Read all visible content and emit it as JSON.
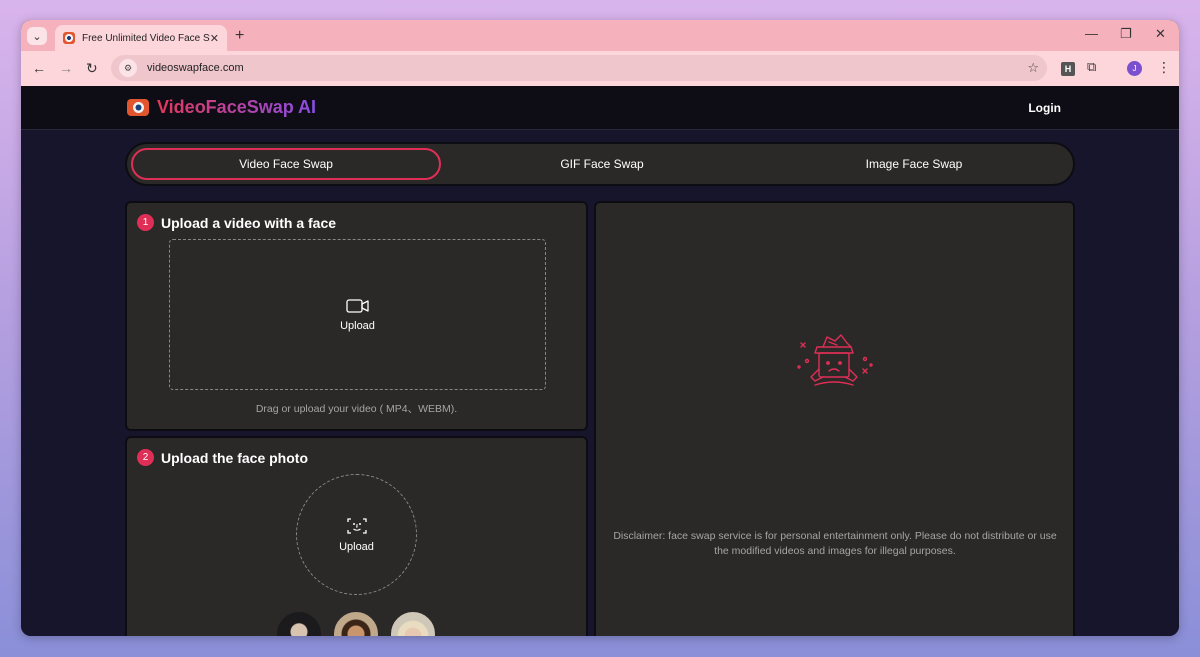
{
  "browser": {
    "tab_title": "Free Unlimited Video Face Swap",
    "tab_close": "✕",
    "new_tab": "+",
    "url": "videoswapface.com",
    "extension_h": "H",
    "profile_initial": "J",
    "icons": {
      "tab_search": "chevron-down-icon",
      "back": "back-arrow-icon",
      "forward": "forward-arrow-icon",
      "reload": "reload-icon",
      "site_info": "site-info-icon",
      "bookmark": "star-icon",
      "extensions": "puzzle-icon",
      "menu": "vertical-dots-icon",
      "minimize": "minimize-icon",
      "restore": "restore-icon",
      "close": "close-icon"
    }
  },
  "site": {
    "logo_text": "VideoFaceSwap AI",
    "login": "Login"
  },
  "modes": [
    {
      "label": "Video Face Swap",
      "active": true
    },
    {
      "label": "GIF Face Swap",
      "active": false
    },
    {
      "label": "Image Face Swap",
      "active": false
    }
  ],
  "step1": {
    "number": "1",
    "title": "Upload a video with a face",
    "upload_label": "Upload",
    "hint": "Drag or upload your video ( MP4、WEBM)."
  },
  "step2": {
    "number": "2",
    "title": "Upload the face photo",
    "upload_label": "Upload"
  },
  "result": {
    "disclaimer": "Disclaimer: face swap service is for personal entertainment only. Please do not distribute or use the modified videos and images for illegal purposes."
  },
  "colors": {
    "accent": "#e02f57",
    "card_bg": "#2b2828",
    "page_bg": "#16152c",
    "tab_strip": "#f5b2bd"
  }
}
